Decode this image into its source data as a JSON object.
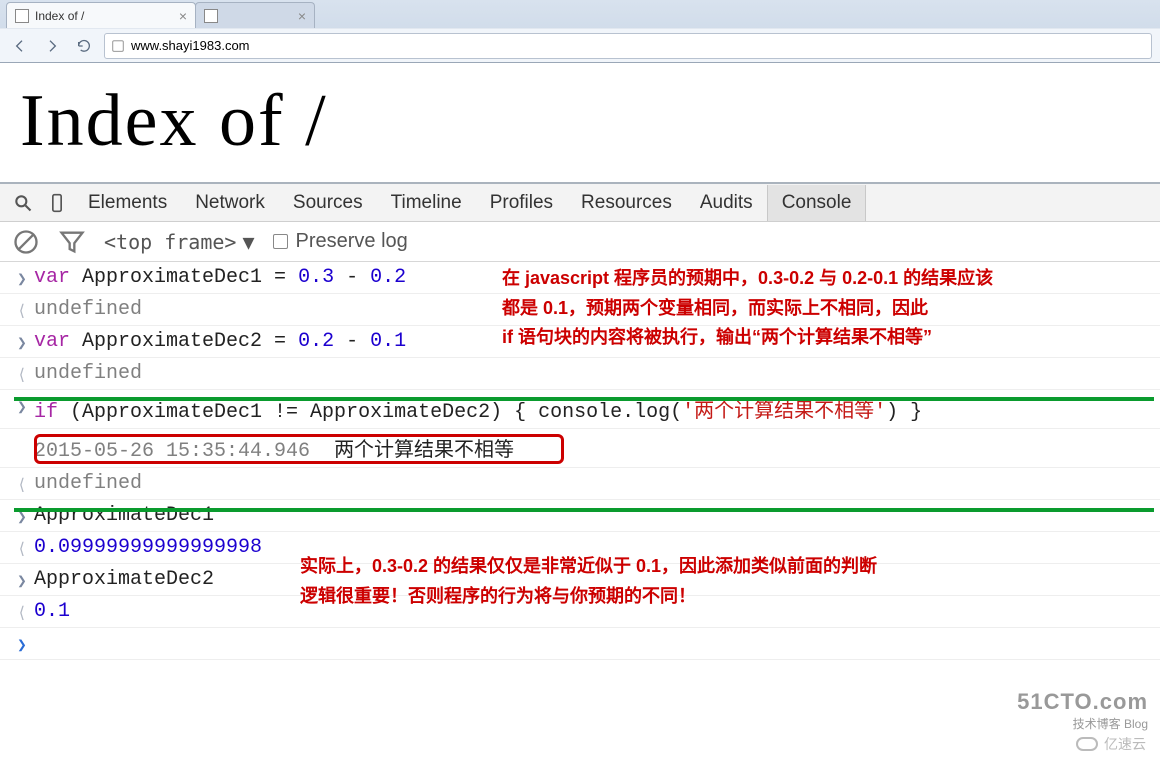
{
  "browser": {
    "tabs": [
      {
        "title": "Index of /",
        "active": true
      },
      {
        "title": "",
        "active": false
      }
    ],
    "url": "www.shayi1983.com"
  },
  "page": {
    "heading": "Index of /"
  },
  "devtools": {
    "tabs": [
      "Elements",
      "Network",
      "Sources",
      "Timeline",
      "Profiles",
      "Resources",
      "Audits",
      "Console"
    ],
    "active_tab": "Console",
    "frame_label": "<top frame>",
    "preserve_label": "Preserve log"
  },
  "console": {
    "lines": [
      {
        "type": "input",
        "parts": [
          [
            "kw",
            "var"
          ],
          [
            "",
            " ApproximateDec1 = "
          ],
          [
            "num",
            "0.3"
          ],
          [
            "",
            " - "
          ],
          [
            "num",
            "0.2"
          ]
        ]
      },
      {
        "type": "output",
        "text": "undefined",
        "cls": "tok-undef"
      },
      {
        "type": "input",
        "parts": [
          [
            "kw",
            "var"
          ],
          [
            "",
            " ApproximateDec2 = "
          ],
          [
            "num",
            "0.2"
          ],
          [
            "",
            " - "
          ],
          [
            "num",
            "0.1"
          ]
        ]
      },
      {
        "type": "output",
        "text": "undefined",
        "cls": "tok-undef"
      },
      {
        "type": "input",
        "parts": [
          [
            "kw",
            "if"
          ],
          [
            "",
            " (ApproximateDec1 != ApproximateDec2) { console.log("
          ],
          [
            "str",
            "'两个计算结果不相等'"
          ],
          [
            "",
            ") }"
          ]
        ]
      },
      {
        "type": "log",
        "ts": "2015-05-26 15:35:44.946",
        "msg": "两个计算结果不相等"
      },
      {
        "type": "output",
        "text": "undefined",
        "cls": "tok-undef"
      },
      {
        "type": "input",
        "parts": [
          [
            "",
            "ApproximateDec1"
          ]
        ]
      },
      {
        "type": "output",
        "text": "0.09999999999999998",
        "cls": "tok-num"
      },
      {
        "type": "input",
        "parts": [
          [
            "",
            "ApproximateDec2"
          ]
        ]
      },
      {
        "type": "output",
        "text": "0.1",
        "cls": "tok-num"
      },
      {
        "type": "prompt"
      }
    ]
  },
  "annotations": {
    "a1_l1": "在 javascript 程序员的预期中，0.3-0.2 与 0.2-0.1 的结果应该",
    "a1_l2": "都是 0.1，预期两个变量相同，而实际上不相同，因此",
    "a1_l3": " if 语句块的内容将被执行，输出“两个计算结果不相等”",
    "a2_l1": "实际上，0.3-0.2 的结果仅仅是非常近似于 0.1，因此添加类似前面的判断",
    "a2_l2": "逻辑很重要！否则程序的行为将与你预期的不同！"
  },
  "watermarks": {
    "w1_a": "51CTO.com",
    "w1_b": "技术博客  Blog",
    "w2": "亿速云"
  }
}
